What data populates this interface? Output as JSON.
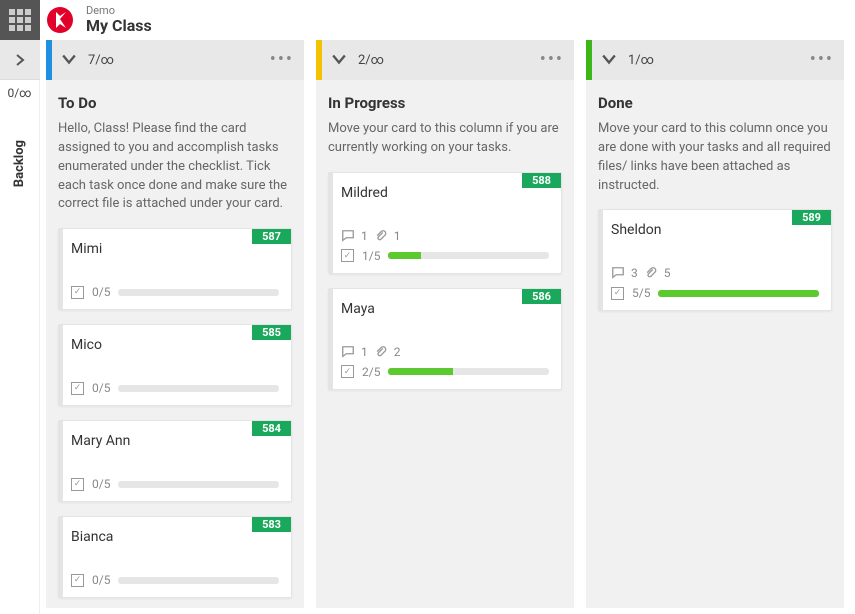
{
  "header": {
    "sub": "Demo",
    "title": "My Class"
  },
  "backlog": {
    "label": "Backlog",
    "count": "0/∞"
  },
  "columns": [
    {
      "stripe": "#1e90e0",
      "count": "7/∞",
      "title": "To Do",
      "desc": "Hello, Class! Please find the card assigned to you and accomplish tasks enumerated under the checklist. Tick each task once done and make sure the correct file is attached under your card.",
      "cards": [
        {
          "id": "587",
          "title": "Mimi",
          "check": "0/5",
          "progress": 0
        },
        {
          "id": "585",
          "title": "Mico",
          "check": "0/5",
          "progress": 0
        },
        {
          "id": "584",
          "title": "Mary Ann",
          "check": "0/5",
          "progress": 0
        },
        {
          "id": "583",
          "title": "Bianca",
          "check": "0/5",
          "progress": 0
        }
      ]
    },
    {
      "stripe": "#f3c200",
      "count": "2/∞",
      "title": "In Progress",
      "desc": "Move your card to this column if you are currently working on your tasks.",
      "cards": [
        {
          "id": "588",
          "title": "Mildred",
          "comments": "1",
          "attach": "1",
          "check": "1/5",
          "progress": 20
        },
        {
          "id": "586",
          "title": "Maya",
          "comments": "1",
          "attach": "2",
          "check": "2/5",
          "progress": 40
        }
      ]
    },
    {
      "stripe": "#3fb618",
      "count": "1/∞",
      "title": "Done",
      "desc": "Move your card to this column once you are done with your tasks and all required files/ links have been attached as instructed.",
      "cards": [
        {
          "id": "589",
          "title": "Sheldon",
          "comments": "3",
          "attach": "5",
          "check": "5/5",
          "progress": 100
        }
      ]
    }
  ]
}
